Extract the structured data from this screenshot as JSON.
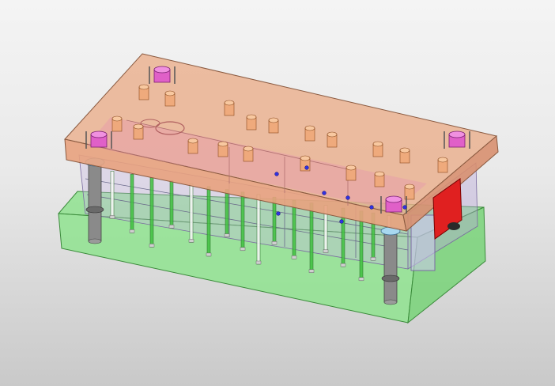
{
  "viewport": {
    "background_top": "#f4f4f4",
    "background_bottom": "#c9c9c9"
  },
  "model": {
    "colors": {
      "top_plate": "#e8a27e",
      "top_plate_front": "#e4aa8c",
      "bottom_plate": "#7fe07f",
      "bottom_plate_front": "#8fe38f",
      "middle_plates": "#c8b6e6",
      "bushing": "#f0a878",
      "magenta_cap": "#e060c8",
      "guide_post": "#8a8a8a",
      "guide_ring": "#a8d8f0",
      "red_block": "#e02020",
      "green_pin": "#40c040",
      "blue_screw": "#3030e0"
    },
    "icons": [
      "guide-post-icon",
      "bushing-icon",
      "magenta-cap-icon",
      "red-block-icon"
    ]
  }
}
